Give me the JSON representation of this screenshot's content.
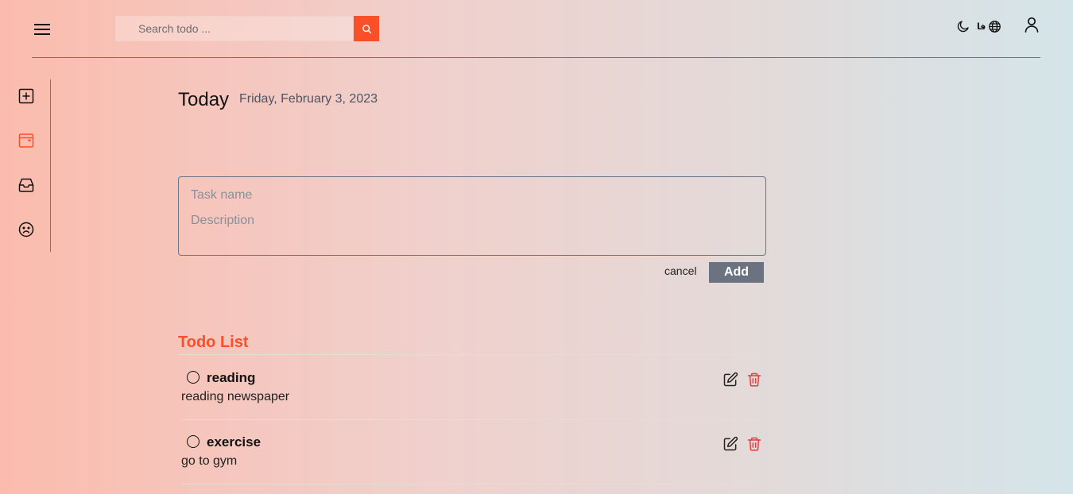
{
  "header": {
    "menu_icon": "hamburger-menu-icon",
    "search": {
      "placeholder": "Search todo ...",
      "value": "",
      "button_icon": "search-icon"
    },
    "theme_icon": "moon-icon",
    "language": {
      "label": "فا",
      "icon": "globe-icon"
    },
    "user_icon": "user-icon"
  },
  "sidebar": {
    "items": [
      {
        "name": "add-task",
        "icon": "plus-square-icon",
        "active": false
      },
      {
        "name": "today",
        "icon": "calendar-icon",
        "active": true
      },
      {
        "name": "inbox",
        "icon": "inbox-icon",
        "active": false
      },
      {
        "name": "mood",
        "icon": "sad-face-icon",
        "active": false
      }
    ]
  },
  "main": {
    "title": "Today",
    "date": "Friday, February 3, 2023",
    "form": {
      "task_name_placeholder": "Task name",
      "description_placeholder": "Description",
      "cancel_label": "cancel",
      "add_label": "Add"
    },
    "list": {
      "title": "Todo List",
      "items": [
        {
          "title": "reading",
          "description": "reading newspaper",
          "completed": false
        },
        {
          "title": "exercise",
          "description": "go to gym",
          "completed": false
        }
      ]
    }
  },
  "colors": {
    "accent": "#f9502a",
    "button_gray": "#6b7280",
    "delete_red": "#e53e3e",
    "divider": "#6c7383"
  }
}
